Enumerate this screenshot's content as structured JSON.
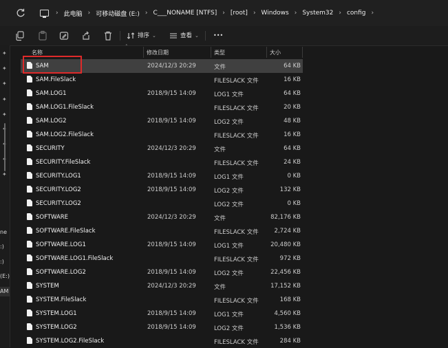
{
  "address_bar": {
    "crumbs": [
      "此电脑",
      "可移动磁盘 (E:)",
      "C___NONAME [NTFS]",
      "[root]",
      "Windows",
      "System32",
      "config"
    ]
  },
  "toolbar": {
    "sort_label": "排序",
    "view_label": "查看",
    "more_label": "•••"
  },
  "left_pane": {
    "labels": [
      "ne",
      ":)",
      ":)",
      "(E:)",
      "AM"
    ]
  },
  "columns": {
    "name": "名称",
    "date": "修改日期",
    "type": "类型",
    "size": "大小"
  },
  "files": [
    {
      "name": "SAM",
      "date": "2024/12/3 20:29",
      "type": "文件",
      "size": "64 KB"
    },
    {
      "name": "SAM.FileSlack",
      "date": "",
      "type": "FILESLACK 文件",
      "size": "16 KB"
    },
    {
      "name": "SAM.LOG1",
      "date": "2018/9/15 14:09",
      "type": "LOG1 文件",
      "size": "64 KB"
    },
    {
      "name": "SAM.LOG1.FileSlack",
      "date": "",
      "type": "FILESLACK 文件",
      "size": "20 KB"
    },
    {
      "name": "SAM.LOG2",
      "date": "2018/9/15 14:09",
      "type": "LOG2 文件",
      "size": "48 KB"
    },
    {
      "name": "SAM.LOG2.FileSlack",
      "date": "",
      "type": "FILESLACK 文件",
      "size": "16 KB"
    },
    {
      "name": "SECURITY",
      "date": "2024/12/3 20:29",
      "type": "文件",
      "size": "64 KB"
    },
    {
      "name": "SECURITY.FileSlack",
      "date": "",
      "type": "FILESLACK 文件",
      "size": "24 KB"
    },
    {
      "name": "SECURITY.LOG1",
      "date": "2018/9/15 14:09",
      "type": "LOG1 文件",
      "size": "0 KB"
    },
    {
      "name": "SECURITY.LOG2",
      "date": "2018/9/15 14:09",
      "type": "LOG2 文件",
      "size": "132 KB"
    },
    {
      "name": "SECURITY.LOG2",
      "date": "",
      "type": "LOG2 文件",
      "size": "0 KB"
    },
    {
      "name": "SOFTWARE",
      "date": "2024/12/3 20:29",
      "type": "文件",
      "size": "82,176 KB"
    },
    {
      "name": "SOFTWARE.FileSlack",
      "date": "",
      "type": "FILESLACK 文件",
      "size": "2,724 KB"
    },
    {
      "name": "SOFTWARE.LOG1",
      "date": "2018/9/15 14:09",
      "type": "LOG1 文件",
      "size": "20,480 KB"
    },
    {
      "name": "SOFTWARE.LOG1.FileSlack",
      "date": "",
      "type": "FILESLACK 文件",
      "size": "972 KB"
    },
    {
      "name": "SOFTWARE.LOG2",
      "date": "2018/9/15 14:09",
      "type": "LOG2 文件",
      "size": "22,456 KB"
    },
    {
      "name": "SYSTEM",
      "date": "2024/12/3 20:29",
      "type": "文件",
      "size": "17,152 KB"
    },
    {
      "name": "SYSTEM.FileSlack",
      "date": "",
      "type": "FILESLACK 文件",
      "size": "168 KB"
    },
    {
      "name": "SYSTEM.LOG1",
      "date": "2018/9/15 14:09",
      "type": "LOG1 文件",
      "size": "4,560 KB"
    },
    {
      "name": "SYSTEM.LOG2",
      "date": "2018/9/15 14:09",
      "type": "LOG2 文件",
      "size": "1,536 KB"
    },
    {
      "name": "SYSTEM.LOG2.FileSlack",
      "date": "",
      "type": "FILESLACK 文件",
      "size": "284 KB"
    }
  ],
  "selected_index": 0,
  "colors": {
    "background": "#191919",
    "selected_row": "#404040",
    "highlight_box": "#e02a2a"
  }
}
